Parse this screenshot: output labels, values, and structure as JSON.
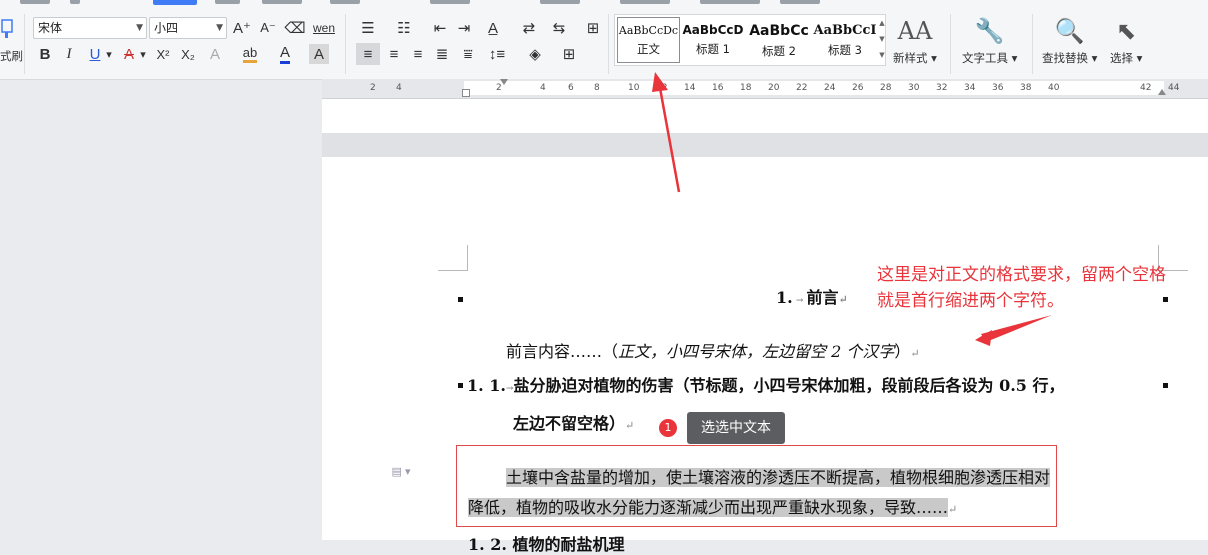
{
  "ribbon": {
    "format_painter_label": "式刷",
    "font_name": "宋体",
    "font_size": "小四",
    "bold": "B",
    "italic": "I",
    "underline": "U",
    "strike": "A",
    "superscript": "X²",
    "subscript": "X₂",
    "font_color": "A",
    "char_shading": "A",
    "grow_font": "A⁺",
    "shrink_font": "A⁻",
    "highlight": "ab",
    "pinyin": "wen",
    "styles": [
      {
        "preview": "AaBbCcDc",
        "name": "正文"
      },
      {
        "preview": "AaBbCcD",
        "name": "标题 1"
      },
      {
        "preview": "AaBbCc",
        "name": "标题 2"
      },
      {
        "preview": "AaBbCcI",
        "name": "标题 3"
      }
    ],
    "new_style_label": "新样式",
    "text_tool_label": "文字工具",
    "find_replace_label": "查找替换",
    "select_label": "选择"
  },
  "ruler": {
    "ticks": [
      "2",
      "4",
      "2",
      "4",
      "6",
      "8",
      "10",
      "12",
      "14",
      "16",
      "18",
      "20",
      "22",
      "24",
      "26",
      "28",
      "30",
      "32",
      "34",
      "36",
      "38",
      "40",
      "42",
      "44"
    ]
  },
  "document": {
    "heading_number": "1.",
    "heading_text": "前言",
    "body_intro": "前言内容……（",
    "body_italic": "正文，小四号宋体，左边留空 2 个汉字",
    "body_close": "）",
    "sub_number": "1. 1.",
    "sub_title_line1": "盐分胁迫对植物的伤害（节标题，小四号宋体加粗，段前段后各设为 0.5 行，",
    "sub_title_line2": "左边不留空格）",
    "para_line1": "土壤中含盐量的增加，使土壤溶液的渗透压不断提高，植物根细胞渗透压相对",
    "para_line2": "降低，植物的吸收水分能力逐渐减少而出现严重缺水现象，导致……",
    "next_heading": "1. 2. 植物的耐盐机理"
  },
  "annotation": {
    "line1": "这里是对正文的格式要求，留两个空格",
    "line2": "就是首行缩进两个字符。"
  },
  "tooltip": {
    "badge": "1",
    "text": "选选中文本"
  },
  "colors": {
    "accent": "#e8343a",
    "tooltip_bg": "#5b5d61",
    "selection": "#c9c9c9"
  }
}
